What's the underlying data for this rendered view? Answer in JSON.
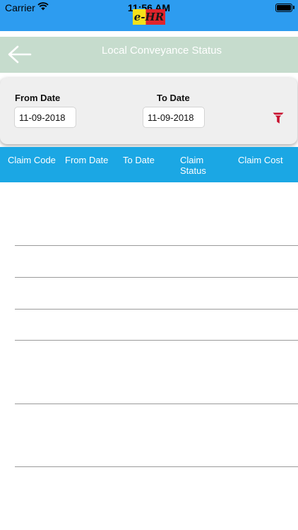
{
  "status_bar": {
    "carrier": "Carrier",
    "time": "11:56 AM",
    "logo_text": "e-HR"
  },
  "header": {
    "title": "Local Conveyance Status",
    "back_icon": "arrow-left-icon"
  },
  "filter": {
    "from_label": "From Date",
    "from_value": "11-09-2018",
    "to_label": "To Date",
    "to_value": "11-09-2018",
    "filter_icon": "filter-funnel-icon"
  },
  "table": {
    "columns": [
      "Claim Code",
      "From Date",
      "To Date",
      "Claim Status",
      "Claim Cost"
    ],
    "rows": []
  },
  "colors": {
    "status_bar": "#2d9cf0",
    "header_bg": "#c6dccd",
    "table_header": "#1ba7e4",
    "filter_icon": "#c8102e"
  }
}
